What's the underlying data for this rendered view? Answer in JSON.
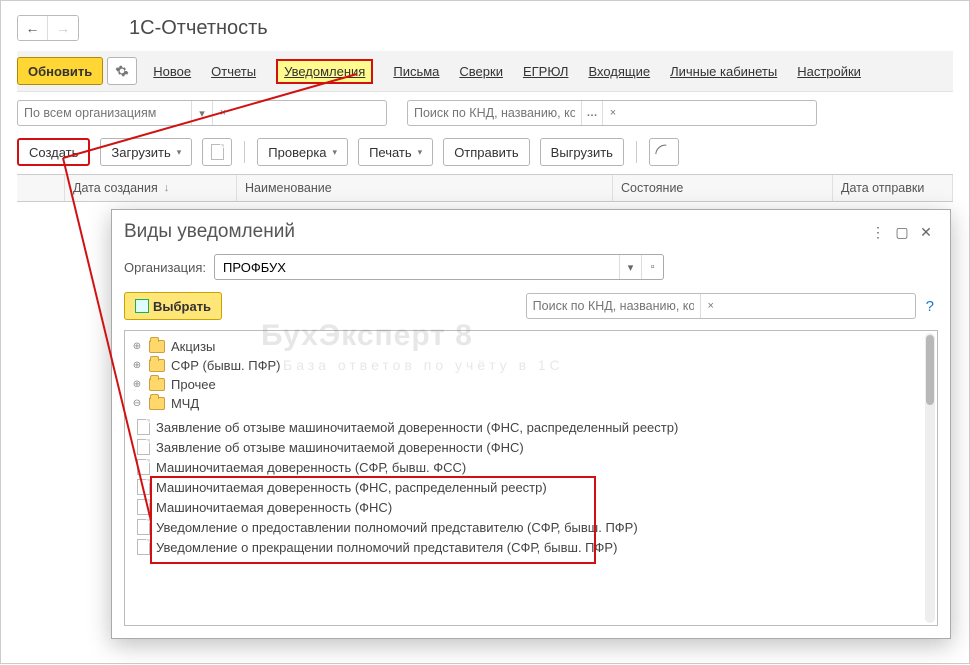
{
  "title": "1С-Отчетность",
  "toolbar": {
    "refresh": "Обновить",
    "nav": {
      "new": "Новое",
      "reports": "Отчеты",
      "notifications": "Уведомления",
      "letters": "Письма",
      "reconciliations": "Сверки",
      "egrul": "ЕГРЮЛ",
      "incoming": "Входящие",
      "cabinets": "Личные кабинеты",
      "settings": "Настройки"
    }
  },
  "filters": {
    "org_placeholder": "По всем организациям",
    "search_placeholder": "Поиск по КНД, названию, контролирующему о..."
  },
  "actions": {
    "create": "Создать",
    "load": "Загрузить",
    "check": "Проверка",
    "print": "Печать",
    "send": "Отправить",
    "export": "Выгрузить"
  },
  "grid": {
    "col_date": "Дата создания",
    "col_name": "Наименование",
    "col_state": "Состояние",
    "col_sent": "Дата отправки"
  },
  "dialog": {
    "title": "Виды уведомлений",
    "org_label": "Организация:",
    "org_value": "ПРОФБУХ",
    "select": "Выбрать",
    "search_placeholder": "Поиск по КНД, названию, контролирующему органу",
    "tree": {
      "n0": "Акцизы",
      "n1": "СФР (бывш. ПФР)",
      "n2": "Прочее",
      "n3": "МЧД",
      "n3_children": {
        "c0": "Заявление об отзыве машиночитаемой доверенности (ФНС, распределенный реестр)",
        "c1": "Заявление об отзыве машиночитаемой доверенности (ФНС)",
        "c2": "Машиночитаемая доверенность (СФР, бывш. ФСС)",
        "c3": "Машиночитаемая доверенность (ФНС, распределенный реестр)",
        "c4": "Машиночитаемая доверенность (ФНС)",
        "c5": "Уведомление о предоставлении полномочий представителю (СФР, бывш. ПФР)",
        "c6": "Уведомление о прекращении полномочий представителя (СФР, бывш. ПФР)"
      }
    }
  },
  "watermark": {
    "main": "БухЭксперт 8",
    "sub": "База ответов по учёту в 1С"
  }
}
